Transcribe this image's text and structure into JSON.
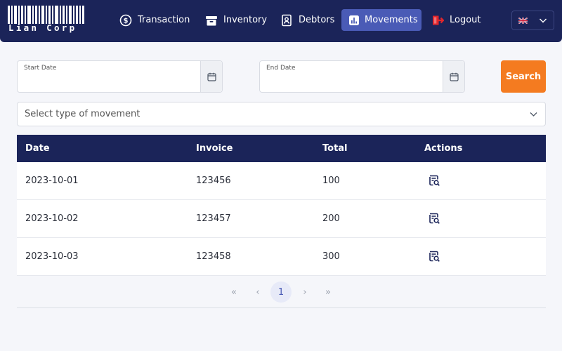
{
  "brand": {
    "name": "Lian Corp"
  },
  "nav": {
    "transaction": "Transaction",
    "inventory": "Inventory",
    "debtors": "Debtors",
    "movements": "Movements",
    "logout": "Logout",
    "active": "movements",
    "accent": "#4a5bb6"
  },
  "language": {
    "flag_icon": "uk-flag-icon"
  },
  "filters": {
    "start_date_label": "Start Date",
    "start_date_value": "",
    "end_date_label": "End Date",
    "end_date_value": "",
    "search_label": "Search",
    "search_color": "#f47b20",
    "movement_type_placeholder": "Select type of movement"
  },
  "table": {
    "headers": [
      "Date",
      "Invoice",
      "Total",
      "Actions"
    ],
    "header_bg": "#1b2459",
    "rows": [
      {
        "date": "2023-10-01",
        "invoice": "123456",
        "total": "100",
        "action_icon": "view-invoice-icon"
      },
      {
        "date": "2023-10-02",
        "invoice": "123457",
        "total": "200",
        "action_icon": "view-invoice-icon"
      },
      {
        "date": "2023-10-03",
        "invoice": "123458",
        "total": "300",
        "action_icon": "view-invoice-icon"
      }
    ]
  },
  "pagination": {
    "first": "«",
    "prev": "‹",
    "current": "1",
    "next": "›",
    "last": "»"
  }
}
